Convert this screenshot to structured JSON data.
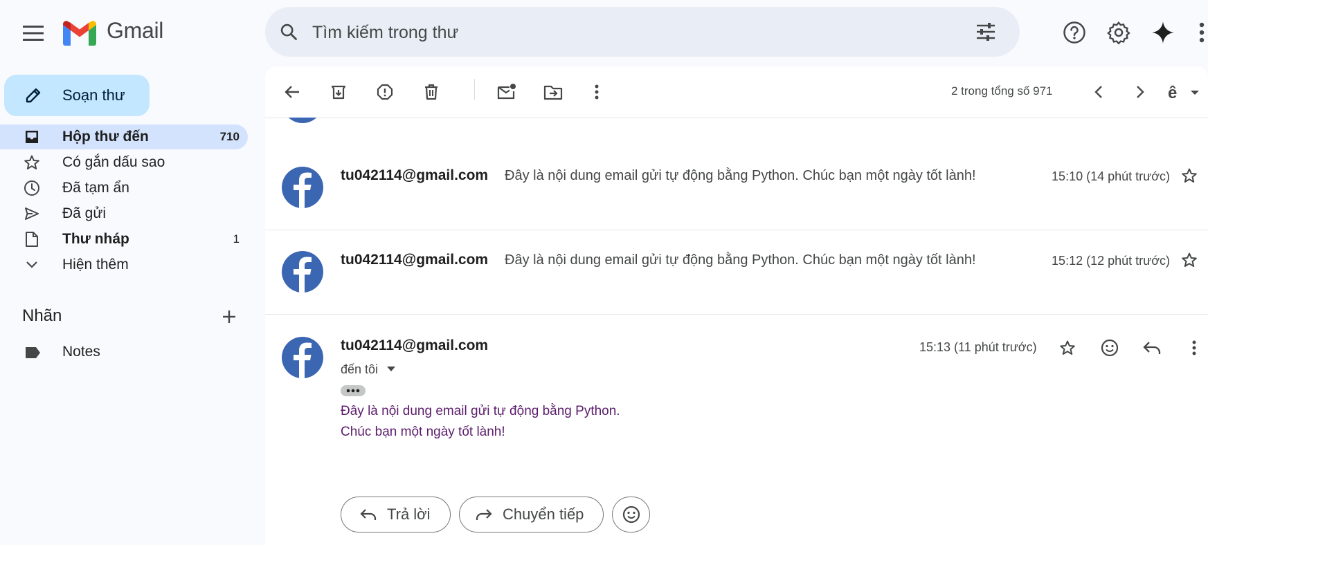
{
  "app": {
    "name": "Gmail"
  },
  "search": {
    "placeholder": "Tìm kiếm trong thư"
  },
  "compose": {
    "label": "Soạn thư"
  },
  "nav": [
    {
      "label": "Hộp thư đến",
      "count": "710",
      "icon": "inbox-icon"
    },
    {
      "label": "Có gắn dấu sao",
      "count": "",
      "icon": "star-icon"
    },
    {
      "label": "Đã tạm ẩn",
      "count": "",
      "icon": "clock-icon"
    },
    {
      "label": "Đã gửi",
      "count": "",
      "icon": "send-icon"
    },
    {
      "label": "Thư nháp",
      "count": "1",
      "icon": "draft-icon"
    },
    {
      "label": "Hiện thêm",
      "count": "",
      "icon": "chevron-down-icon"
    }
  ],
  "labels": {
    "title": "Nhãn",
    "items": [
      {
        "label": "Notes",
        "icon": "label-icon"
      }
    ]
  },
  "toolbar": {
    "pager": "2 trong tổng số 971",
    "icons": [
      "back-icon",
      "archive-icon",
      "report-spam-icon",
      "delete-icon",
      "mark-unread-icon",
      "move-to-icon",
      "more-icon",
      "prev-icon",
      "next-icon",
      "input-tools-icon"
    ]
  },
  "thread": [
    {
      "sender": "tu042114@gmail.com",
      "snippet": "Đây là nội dung email gửi tự động bằng Python. Chúc bạn một ngày tốt lành!",
      "time": "15:10 (14 phút trước)"
    },
    {
      "sender": "tu042114@gmail.com",
      "snippet": "Đây là nội dung email gửi tự động bằng Python. Chúc bạn một ngày tốt lành!",
      "time": "15:12 (12 phút trước)"
    }
  ],
  "open_message": {
    "sender": "tu042114@gmail.com",
    "time": "15:13 (11 phút trước)",
    "recipient": "đến tôi",
    "body": [
      "Đây là nội dung email gửi tự động bằng Python.",
      "Chúc bạn một ngày tốt lành!"
    ]
  },
  "actions": {
    "reply": "Trả lời",
    "forward": "Chuyển tiếp"
  },
  "colors": {
    "sidebar_bg": "#f8fafd",
    "compose_bg": "#c2e7ff",
    "active_nav_bg": "#d3e3fd",
    "search_bg": "#e9eef6",
    "avatar_bg": "#3b66b2",
    "body_text": "#5b1c6b"
  }
}
